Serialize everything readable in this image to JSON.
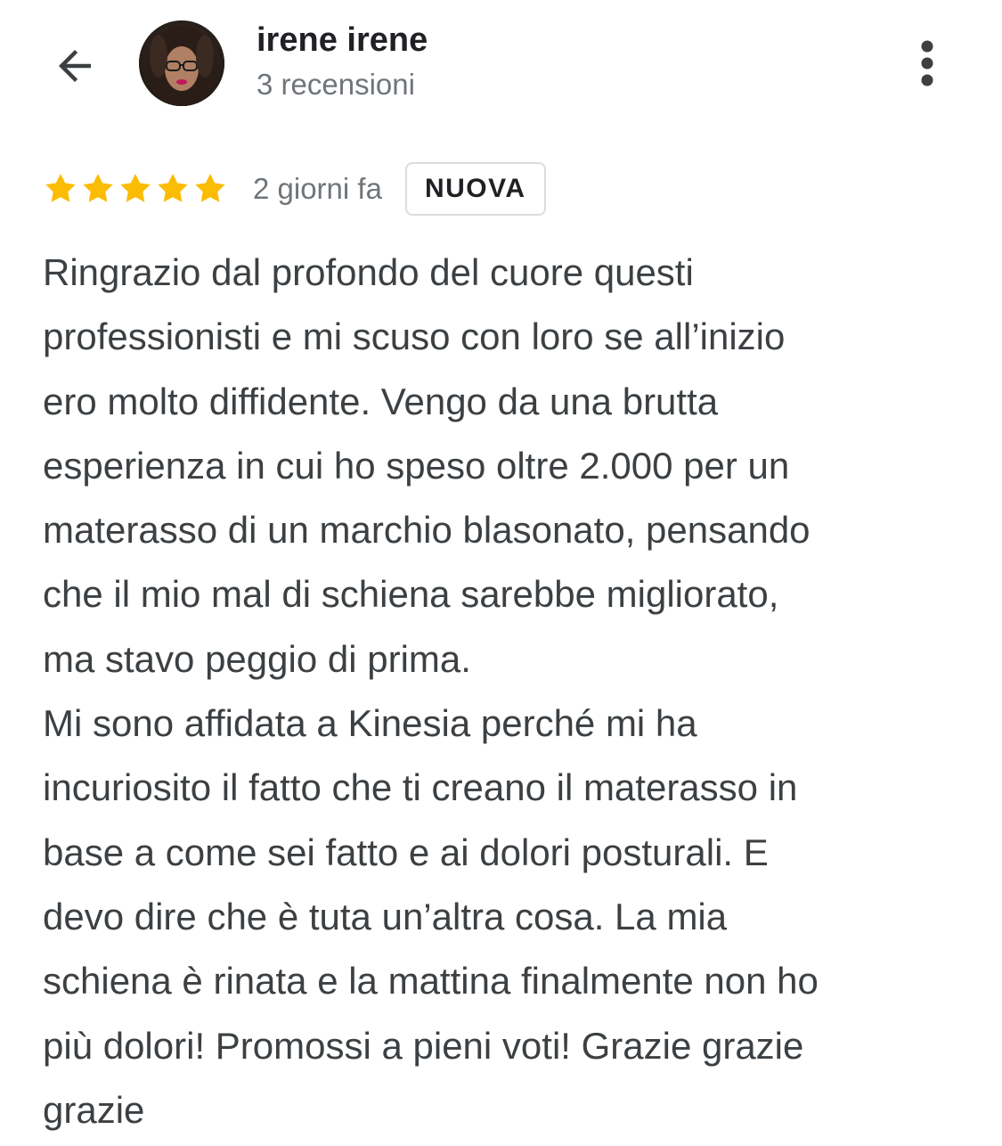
{
  "header": {
    "back_icon": "arrow-left-icon",
    "reviewer_name": "irene irene",
    "review_count": "3 recensioni",
    "more_icon": "more-vertical-icon"
  },
  "review": {
    "rating": 5,
    "rating_max": 5,
    "star_color": "#fbbc04",
    "date": "2 giorni fa",
    "badge": "NUOVA",
    "text": "Ringrazio dal profondo del cuore questi\nprofessionisti e mi scuso con loro se all’inizio\nero molto diffidente. Vengo da una brutta\nesperienza in cui ho speso oltre 2.000 per un\nmaterasso di un marchio blasonato, pensando\nche il mio mal di schiena sarebbe migliorato,\nma stavo peggio di prima.\nMi sono affidata a Kinesia perché mi ha\nincuriosito il fatto che ti creano il materasso in\nbase a come sei fatto e ai dolori posturali. E\ndevo dire che è tuta un’altra cosa. La mia\nschiena è rinata e la mattina finalmente non ho\npiù dolori! Promossi a pieni voti! Grazie grazie\ngrazie"
  }
}
